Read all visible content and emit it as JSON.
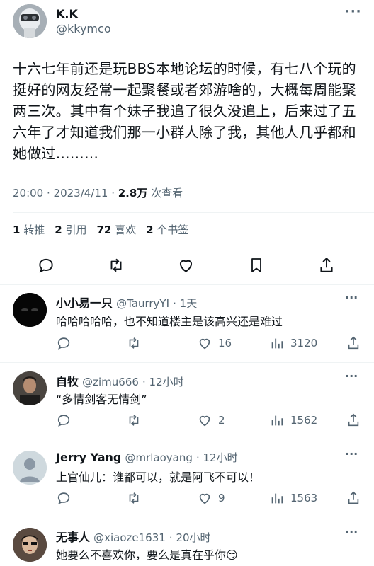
{
  "tweet": {
    "name": "K.K",
    "handle": "@kkymco",
    "text": "十六七年前还是玩BBS本地论坛的时候，有七八个玩的挺好的网友经常一起聚餐或者郊游啥的，大概每周能聚两三次。其中有个妹子我追了很久没追上，后来过了五六年了才知道我们那一小群人除了我，其他人几乎都和她做过………",
    "lines": [
      "十六七年前还是玩BBS本地论坛的时候，有七八个玩的",
      "挺好的网友经常一起聚餐或者郊游啥的，大概每周能聚",
      "两三次。其中有个妹子我追了很久没追上，后来过了五",
      "六年了才知道我们那一小群人除了我，其他人几乎都和",
      "她做过………"
    ],
    "time": "20:00 · 2023/4/11 · ",
    "views_count": "2.8万",
    "views_label": " 次查看",
    "stats": [
      {
        "count": "1",
        "label": "转推"
      },
      {
        "count": "2",
        "label": "引用"
      },
      {
        "count": "72",
        "label": "喜欢"
      },
      {
        "count": "2",
        "label": "个书签"
      }
    ],
    "more": "···"
  },
  "replies": [
    {
      "name": "小小易一只",
      "handle": "@TaurryYI",
      "time": "· 1天",
      "text": "哈哈哈哈哈，也不知道楼主是该高兴还是难过",
      "likes": "16",
      "views": "3120"
    },
    {
      "name": "自牧",
      "handle": "@zimu666",
      "time": "· 12小时",
      "text": "“多情剑客无情剑”",
      "likes": "2",
      "views": "1562"
    },
    {
      "name": "Jerry Yang",
      "handle": "@mrlaoyang",
      "time": "· 12小时",
      "text": "上官仙儿：谁都可以，就是阿飞不可以！",
      "likes": "9",
      "views": "1563"
    },
    {
      "name": "无事人",
      "handle": "@xiaoze1631",
      "time": "· 20小时",
      "text": "她要么不喜欢你，要么是真在乎你😏",
      "likes": "",
      "views": ""
    }
  ],
  "colors": {
    "text": "#0f1419",
    "muted": "#536471",
    "border": "#eff3f4"
  }
}
